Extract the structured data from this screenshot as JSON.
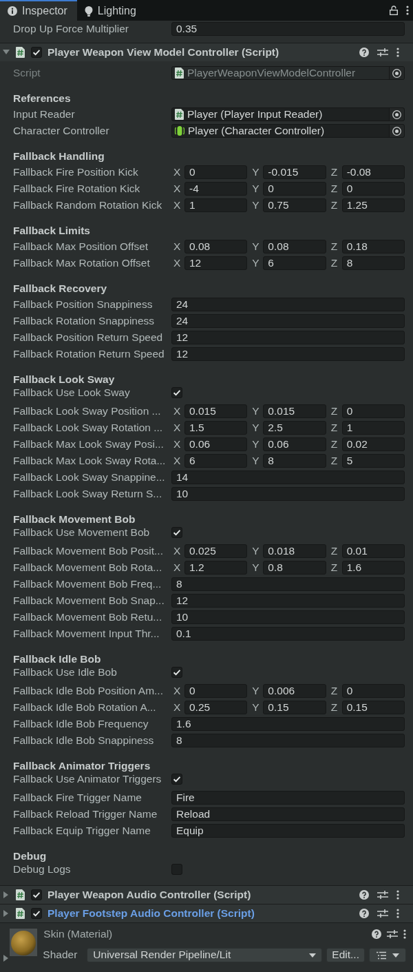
{
  "tabs": [
    {
      "label": "Inspector",
      "selected": true
    },
    {
      "label": "Lighting",
      "selected": false
    }
  ],
  "top_field": {
    "label": "Drop Up Force Multiplier",
    "value": "0.35"
  },
  "components": [
    {
      "title": "Player Weapon View Model Controller (Script)",
      "expanded": true,
      "enabled": true,
      "highlighted": false,
      "script": {
        "label": "Script",
        "value": "PlayerWeaponViewModelController",
        "disabled": true
      },
      "sections": [
        {
          "title": "References",
          "rows": [
            {
              "kind": "script_ref",
              "label": "Input Reader",
              "value": "Player (Player Input Reader)"
            },
            {
              "kind": "component_ref",
              "label": "Character Controller",
              "value": "Player (Character Controller)"
            }
          ]
        },
        {
          "title": "Fallback Handling",
          "rows": [
            {
              "kind": "vector3",
              "label": "Fallback Fire Position Kick",
              "values": [
                {
                  "axis": "X",
                  "value": "0"
                },
                {
                  "axis": "Y",
                  "value": "-0.015"
                },
                {
                  "axis": "Z",
                  "value": "-0.08"
                }
              ]
            },
            {
              "kind": "vector3",
              "label": "Fallback Fire Rotation Kick",
              "values": [
                {
                  "axis": "X",
                  "value": "-4"
                },
                {
                  "axis": "Y",
                  "value": "0"
                },
                {
                  "axis": "Z",
                  "value": "0"
                }
              ]
            },
            {
              "kind": "vector3",
              "label": "Fallback Random Rotation Kick",
              "values": [
                {
                  "axis": "X",
                  "value": "1"
                },
                {
                  "axis": "Y",
                  "value": "0.75"
                },
                {
                  "axis": "Z",
                  "value": "1.25"
                }
              ]
            }
          ]
        },
        {
          "title": "Fallback Limits",
          "rows": [
            {
              "kind": "vector3",
              "label": "Fallback Max Position Offset",
              "values": [
                {
                  "axis": "X",
                  "value": "0.08"
                },
                {
                  "axis": "Y",
                  "value": "0.08"
                },
                {
                  "axis": "Z",
                  "value": "0.18"
                }
              ]
            },
            {
              "kind": "vector3",
              "label": "Fallback Max Rotation Offset",
              "values": [
                {
                  "axis": "X",
                  "value": "12"
                },
                {
                  "axis": "Y",
                  "value": "6"
                },
                {
                  "axis": "Z",
                  "value": "8"
                }
              ]
            }
          ]
        },
        {
          "title": "Fallback Recovery",
          "rows": [
            {
              "kind": "float",
              "label": "Fallback Position Snappiness",
              "value": "24"
            },
            {
              "kind": "float",
              "label": "Fallback Rotation Snappiness",
              "value": "24"
            },
            {
              "kind": "float",
              "label": "Fallback Position Return Speed",
              "value": "12"
            },
            {
              "kind": "float",
              "label": "Fallback Rotation Return Speed",
              "value": "12"
            }
          ]
        },
        {
          "title": "Fallback Look Sway",
          "rows": [
            {
              "kind": "toggle",
              "label": "Fallback Use Look Sway",
              "checked": true
            },
            {
              "kind": "vector3",
              "label": "Fallback Look Sway Position ...",
              "values": [
                {
                  "axis": "X",
                  "value": "0.015"
                },
                {
                  "axis": "Y",
                  "value": "0.015"
                },
                {
                  "axis": "Z",
                  "value": "0"
                }
              ]
            },
            {
              "kind": "vector3",
              "label": "Fallback Look Sway Rotation ...",
              "values": [
                {
                  "axis": "X",
                  "value": "1.5"
                },
                {
                  "axis": "Y",
                  "value": "2.5"
                },
                {
                  "axis": "Z",
                  "value": "1"
                }
              ]
            },
            {
              "kind": "vector3",
              "label": "Fallback Max Look Sway Posi...",
              "values": [
                {
                  "axis": "X",
                  "value": "0.06"
                },
                {
                  "axis": "Y",
                  "value": "0.06"
                },
                {
                  "axis": "Z",
                  "value": "0.02"
                }
              ]
            },
            {
              "kind": "vector3",
              "label": "Fallback Max Look Sway Rota...",
              "values": [
                {
                  "axis": "X",
                  "value": "6"
                },
                {
                  "axis": "Y",
                  "value": "8"
                },
                {
                  "axis": "Z",
                  "value": "5"
                }
              ]
            },
            {
              "kind": "float",
              "label": "Fallback Look Sway Snappine...",
              "value": "14"
            },
            {
              "kind": "float",
              "label": "Fallback Look Sway Return S...",
              "value": "10"
            }
          ]
        },
        {
          "title": "Fallback Movement Bob",
          "rows": [
            {
              "kind": "toggle",
              "label": "Fallback Use Movement Bob",
              "checked": true
            },
            {
              "kind": "vector3",
              "label": "Fallback Movement Bob Posit...",
              "values": [
                {
                  "axis": "X",
                  "value": "0.025"
                },
                {
                  "axis": "Y",
                  "value": "0.018"
                },
                {
                  "axis": "Z",
                  "value": "0.01"
                }
              ]
            },
            {
              "kind": "vector3",
              "label": "Fallback Movement Bob Rota...",
              "values": [
                {
                  "axis": "X",
                  "value": "1.2"
                },
                {
                  "axis": "Y",
                  "value": "0.8"
                },
                {
                  "axis": "Z",
                  "value": "1.6"
                }
              ]
            },
            {
              "kind": "float",
              "label": "Fallback Movement Bob Freq...",
              "value": "8"
            },
            {
              "kind": "float",
              "label": "Fallback Movement Bob Snap...",
              "value": "12"
            },
            {
              "kind": "float",
              "label": "Fallback Movement Bob Retu...",
              "value": "10"
            },
            {
              "kind": "float",
              "label": "Fallback Movement Input Thr...",
              "value": "0.1"
            }
          ]
        },
        {
          "title": "Fallback Idle Bob",
          "rows": [
            {
              "kind": "toggle",
              "label": "Fallback Use Idle Bob",
              "checked": true
            },
            {
              "kind": "vector3",
              "label": "Fallback Idle Bob Position Am...",
              "values": [
                {
                  "axis": "X",
                  "value": "0"
                },
                {
                  "axis": "Y",
                  "value": "0.006"
                },
                {
                  "axis": "Z",
                  "value": "0"
                }
              ]
            },
            {
              "kind": "vector3",
              "label": "Fallback Idle Bob Rotation A...",
              "values": [
                {
                  "axis": "X",
                  "value": "0.25"
                },
                {
                  "axis": "Y",
                  "value": "0.15"
                },
                {
                  "axis": "Z",
                  "value": "0.15"
                }
              ]
            },
            {
              "kind": "float",
              "label": "Fallback Idle Bob Frequency",
              "value": "1.6"
            },
            {
              "kind": "float",
              "label": "Fallback Idle Bob Snappiness",
              "value": "8"
            }
          ]
        },
        {
          "title": "Fallback Animator Triggers",
          "rows": [
            {
              "kind": "toggle",
              "label": "Fallback Use Animator Triggers",
              "checked": true
            },
            {
              "kind": "text",
              "label": "Fallback Fire Trigger Name",
              "value": "Fire"
            },
            {
              "kind": "text",
              "label": "Fallback Reload Trigger Name",
              "value": "Reload"
            },
            {
              "kind": "text",
              "label": "Fallback Equip Trigger Name",
              "value": "Equip"
            }
          ]
        },
        {
          "title": "Debug",
          "rows": [
            {
              "kind": "toggle",
              "label": "Debug Logs",
              "checked": false
            }
          ]
        }
      ]
    },
    {
      "title": "Player Weapon Audio Controller (Script)",
      "expanded": false,
      "enabled": true,
      "highlighted": false
    },
    {
      "title": "Player Footstep Audio Controller (Script)",
      "expanded": false,
      "enabled": true,
      "highlighted": true
    }
  ],
  "material": {
    "title": "Skin (Material)",
    "expanded": false,
    "shader_label": "Shader",
    "shader": "Universal Render Pipeline/Lit",
    "edit_label": "Edit..."
  }
}
